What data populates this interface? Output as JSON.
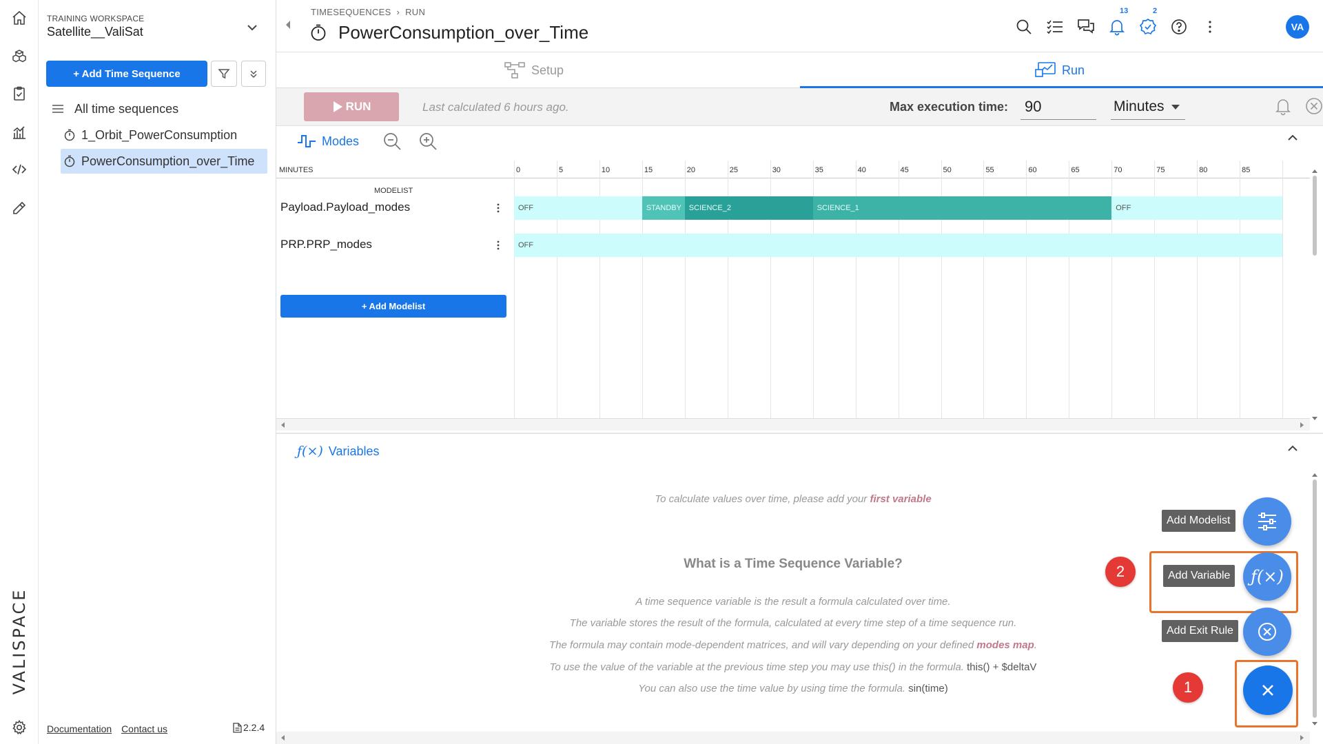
{
  "sidebar": {
    "workspace_label": "TRAINING WORKSPACE",
    "workspace_name": "Satellite__ValiSat",
    "add_button": "+ Add Time Sequence",
    "tree": [
      {
        "label": "All time sequences",
        "icon": "list-icon"
      },
      {
        "label": "1_Orbit_PowerConsumption",
        "icon": "stopwatch-icon"
      },
      {
        "label": "PowerConsumption_over_Time",
        "icon": "stopwatch-icon",
        "selected": true
      }
    ],
    "footer": {
      "documentation": "Documentation",
      "contact": "Contact us",
      "version": "2.2.4"
    },
    "brand": "VALISPACE"
  },
  "header": {
    "breadcrumb": [
      "TIMESEQUENCES",
      "RUN"
    ],
    "title": "PowerConsumption_over_Time",
    "notifications_count": "13",
    "tasks_count": "2",
    "avatar": "VA"
  },
  "tabs": {
    "setup": "Setup",
    "run": "Run",
    "active": "run"
  },
  "runbar": {
    "run_label": "RUN",
    "last_calculated": "Last calculated 6 hours ago.",
    "max_label": "Max execution time:",
    "max_value": "90",
    "unit": "Minutes"
  },
  "modes": {
    "heading": "Modes",
    "minutes_label": "MINUTES",
    "modelist_label": "MODELIST",
    "ticks": [
      "0",
      "5",
      "10",
      "15",
      "20",
      "25",
      "30",
      "35",
      "40",
      "45",
      "50",
      "55",
      "60",
      "65",
      "70",
      "75",
      "80",
      "85"
    ],
    "rows": [
      {
        "name": "Payload.Payload_modes",
        "segments": [
          {
            "label": "OFF",
            "start": 0,
            "end": 15,
            "color": "#ccfcfc"
          },
          {
            "label": "STANDBY",
            "start": 15,
            "end": 20,
            "color": "#4fc3b6"
          },
          {
            "label": "SCIENCE_2",
            "start": 20,
            "end": 35,
            "color": "#2aa198"
          },
          {
            "label": "SCIENCE_1",
            "start": 35,
            "end": 70,
            "color": "#3cb3a6"
          },
          {
            "label": "OFF",
            "start": 70,
            "end": 90,
            "color": "#ccfcfc"
          }
        ]
      },
      {
        "name": "PRP.PRP_modes",
        "segments": [
          {
            "label": "OFF",
            "start": 0,
            "end": 90,
            "color": "#ccfcfc"
          }
        ]
      }
    ],
    "add_modelist": "+ Add Modelist"
  },
  "variables": {
    "heading": "Variables",
    "intro_prefix": "To calculate values over time, please add your ",
    "intro_link": "first variable",
    "what_title": "What is a Time Sequence Variable?",
    "p1": "A time sequence variable is the result a formula calculated over time.",
    "p2": "The variable stores the result of the formula, calculated at every time step of a time sequence run.",
    "p3_prefix": "The formula may contain mode-dependent matrices, and will vary depending on your defined ",
    "p3_link": "modes map",
    "p3_suffix": ".",
    "p4_prefix": "To use the value of the variable at the previous time step you may use this() in the formula. ",
    "p4_code": "this() + $deltaV",
    "p5_prefix": "You can also use the time value by using time the formula. ",
    "p5_code": "sin(time)"
  },
  "fab": {
    "add_modelist": "Add Modelist",
    "add_variable": "Add Variable",
    "add_exit_rule": "Add Exit Rule",
    "step1": "1",
    "step2": "2"
  },
  "colors": {
    "primary": "#1976e8",
    "run_disabled": "#d9a5ae",
    "highlight": "#e8742c",
    "step_badge": "#e53935"
  }
}
